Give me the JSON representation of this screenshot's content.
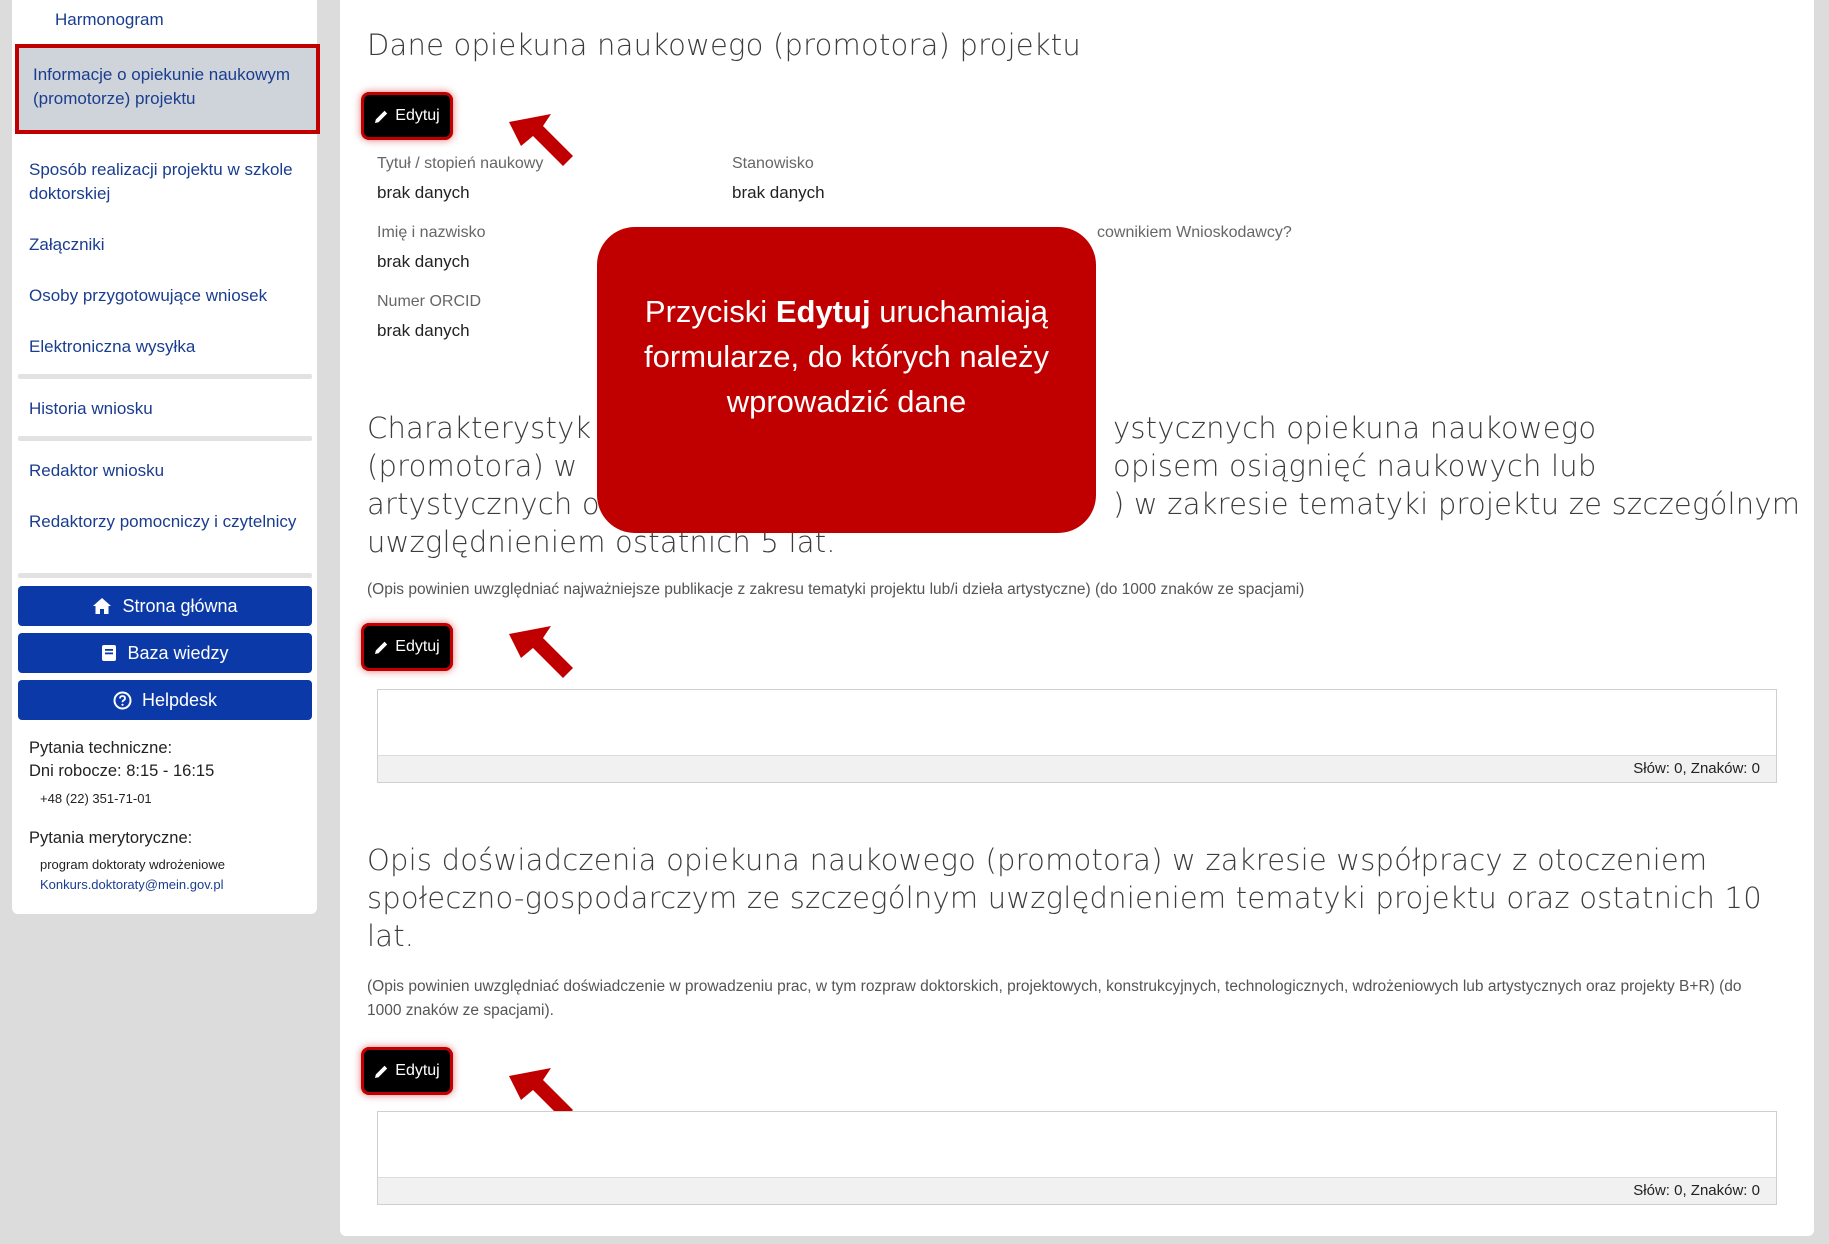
{
  "sidebar": {
    "items": [
      {
        "label": "Harmonogram"
      },
      {
        "label": "Informacje o opiekunie naukowym (promotorze) projektu"
      },
      {
        "label": "Sposób realizacji projektu w szkole doktorskiej"
      },
      {
        "label": "Załączniki"
      },
      {
        "label": "Osoby przygotowujące wniosek"
      },
      {
        "label": "Elektroniczna wysyłka"
      },
      {
        "label": "Historia wniosku"
      },
      {
        "label": "Redaktor wniosku"
      },
      {
        "label": "Redaktorzy pomocniczy i czytelnicy"
      }
    ],
    "buttons": {
      "home": "Strona główna",
      "knowledge": "Baza wiedzy",
      "helpdesk": "Helpdesk"
    },
    "contact": {
      "technical_title": "Pytania techniczne:",
      "technical_hours": "Dni robocze: 8:15 - 16:15",
      "technical_phone": "+48 (22) 351-71-01",
      "substantive_title": "Pytania merytoryczne:",
      "substantive_program": "program doktoraty wdrożeniowe",
      "substantive_email": "Konkurs.doktoraty@mein.gov.pl"
    }
  },
  "main": {
    "section1": {
      "title": "Dane opiekuna naukowego (promotora) projektu",
      "edit_label": "Edytuj",
      "fields": {
        "title_label": "Tytuł / stopień naukowy",
        "title_value": "brak danych",
        "position_label": "Stanowisko",
        "position_value": "brak danych",
        "name_label": "Imię i nazwisko",
        "name_value": "brak danych",
        "employee_label_visible": "cownikiem Wnioskodawcy?",
        "orcid_label": "Numer ORCID",
        "orcid_value": "brak danych"
      }
    },
    "section2": {
      "title_line1_left": "Charakterystyk",
      "title_line1_right": "ystycznych opiekuna naukowego",
      "title_line2_left": "(promotora) w",
      "title_line2_right": "opisem osiągnięć naukowych lub",
      "title_line3_left": "artystycznych o",
      "title_line3_right": ") w zakresie tematyki projektu ze szczególnym",
      "title_line4": "uwzględnieniem ostatnich 5 lat.",
      "hint": "(Opis powinien uwzględniać najważniejsze publikacje z zakresu tematyki projektu lub/i dzieła artystyczne) (do 1000 znaków ze spacjami)",
      "edit_label": "Edytuj",
      "counter": "Słów: 0, Znaków: 0"
    },
    "section3": {
      "title": "Opis doświadczenia opiekuna naukowego (promotora) w zakresie współpracy z otoczeniem społeczno-gospodarczym ze szczególnym uwzględnieniem tematyki projektu oraz ostatnich 10 lat.",
      "hint": "(Opis powinien uwzględniać doświadczenie w prowadzeniu prac, w tym rozpraw doktorskich, projektowych, konstrukcyjnych, technologicznych, wdrożeniowych lub artystycznych oraz projekty B+R) (do 1000 znaków ze spacjami).",
      "edit_label": "Edytuj",
      "counter": "Słów: 0, Znaków: 0"
    }
  },
  "callout": {
    "line_prefix": "Przyciski",
    "line_bold": "Edytuj",
    "line_rest": "uruchamiają formularze, do których należy wprowadzić dane"
  },
  "colors": {
    "accent_red": "#c00000",
    "sidebar_button": "#0b3aa8",
    "link": "#1a3d8f"
  }
}
